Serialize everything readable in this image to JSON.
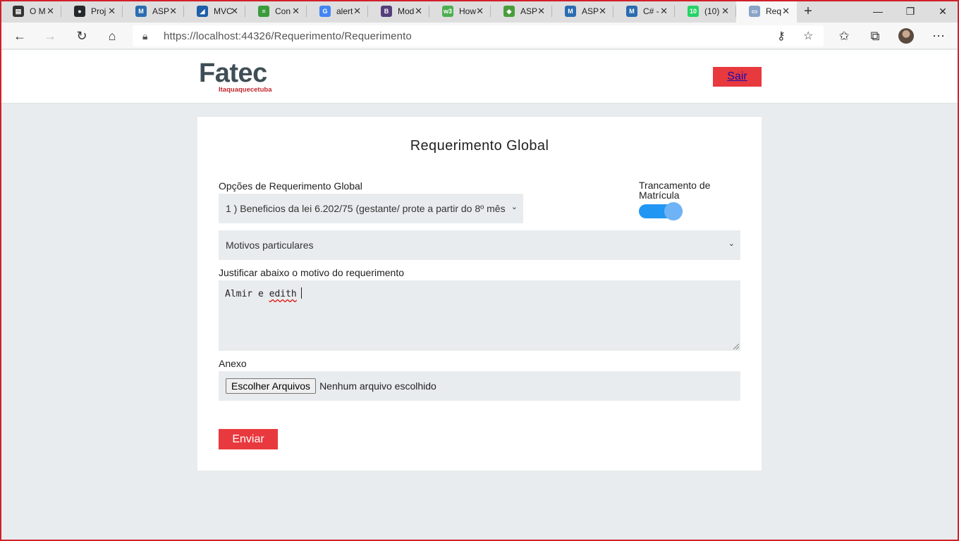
{
  "browser": {
    "tabs": [
      {
        "label": "O M",
        "icon": "page-icon",
        "color": "#333333",
        "glyph": "▤"
      },
      {
        "label": "Proj",
        "icon": "github-icon",
        "color": "#24292e",
        "glyph": "●"
      },
      {
        "label": "ASP",
        "icon": "macoratti-icon",
        "color": "#2b6cb0",
        "glyph": "M"
      },
      {
        "label": "MVC",
        "icon": "arrow-logo-icon",
        "color": "#1d5fa8",
        "glyph": "◢"
      },
      {
        "label": "Con",
        "icon": "stackoverflow-icon",
        "color": "#3a9b3a",
        "glyph": "≡"
      },
      {
        "label": "alert",
        "icon": "google-icon",
        "color": "#4285f4",
        "glyph": "G"
      },
      {
        "label": "Mod",
        "icon": "bootstrap-icon",
        "color": "#563d7c",
        "glyph": "B"
      },
      {
        "label": "How",
        "icon": "w3schools-icon",
        "color": "#4caf50",
        "glyph": "w3"
      },
      {
        "label": "ASP",
        "icon": "aspnet-icon",
        "color": "#4a9d3c",
        "glyph": "◆"
      },
      {
        "label": "ASP",
        "icon": "macoratti-icon",
        "color": "#2b6cb0",
        "glyph": "M"
      },
      {
        "label": "C# -",
        "icon": "macoratti-icon",
        "color": "#2b6cb0",
        "glyph": "M"
      },
      {
        "label": "(10)",
        "icon": "whatsapp-icon",
        "color": "#25d366",
        "glyph": "10"
      },
      {
        "label": "Req",
        "icon": "document-icon",
        "color": "#8aa4c8",
        "glyph": "▭"
      }
    ],
    "url": "https://localhost:44326/Requerimento/Requerimento"
  },
  "header": {
    "logo_text": "Fatec",
    "logo_subtitle": "Itaquaquecetuba",
    "logout_label": "Sair"
  },
  "form": {
    "title": "Requerimento Global",
    "options_label": "Opções de Requerimento Global",
    "options_selected": "1 ) Beneficios da lei 6.202/75 (gestante/ prote a partir do 8º mês",
    "toggle_label": "Trancamento de Matrícula",
    "toggle_on": true,
    "reason_selected": "Motivos particulares",
    "justify_label": "Justificar abaixo o motivo do requerimento",
    "justify_text_plain": "Almir e ",
    "justify_text_flagged": "edith",
    "attachment_label": "Anexo",
    "file_button_label": "Escolher Arquivos",
    "file_status": "Nenhum arquivo escolhido",
    "submit_label": "Enviar"
  },
  "colors": {
    "accent_red": "#e8393e",
    "toggle_blue": "#2196f3",
    "logo_gray": "#3f4e56",
    "logo_red": "#c4262e"
  }
}
